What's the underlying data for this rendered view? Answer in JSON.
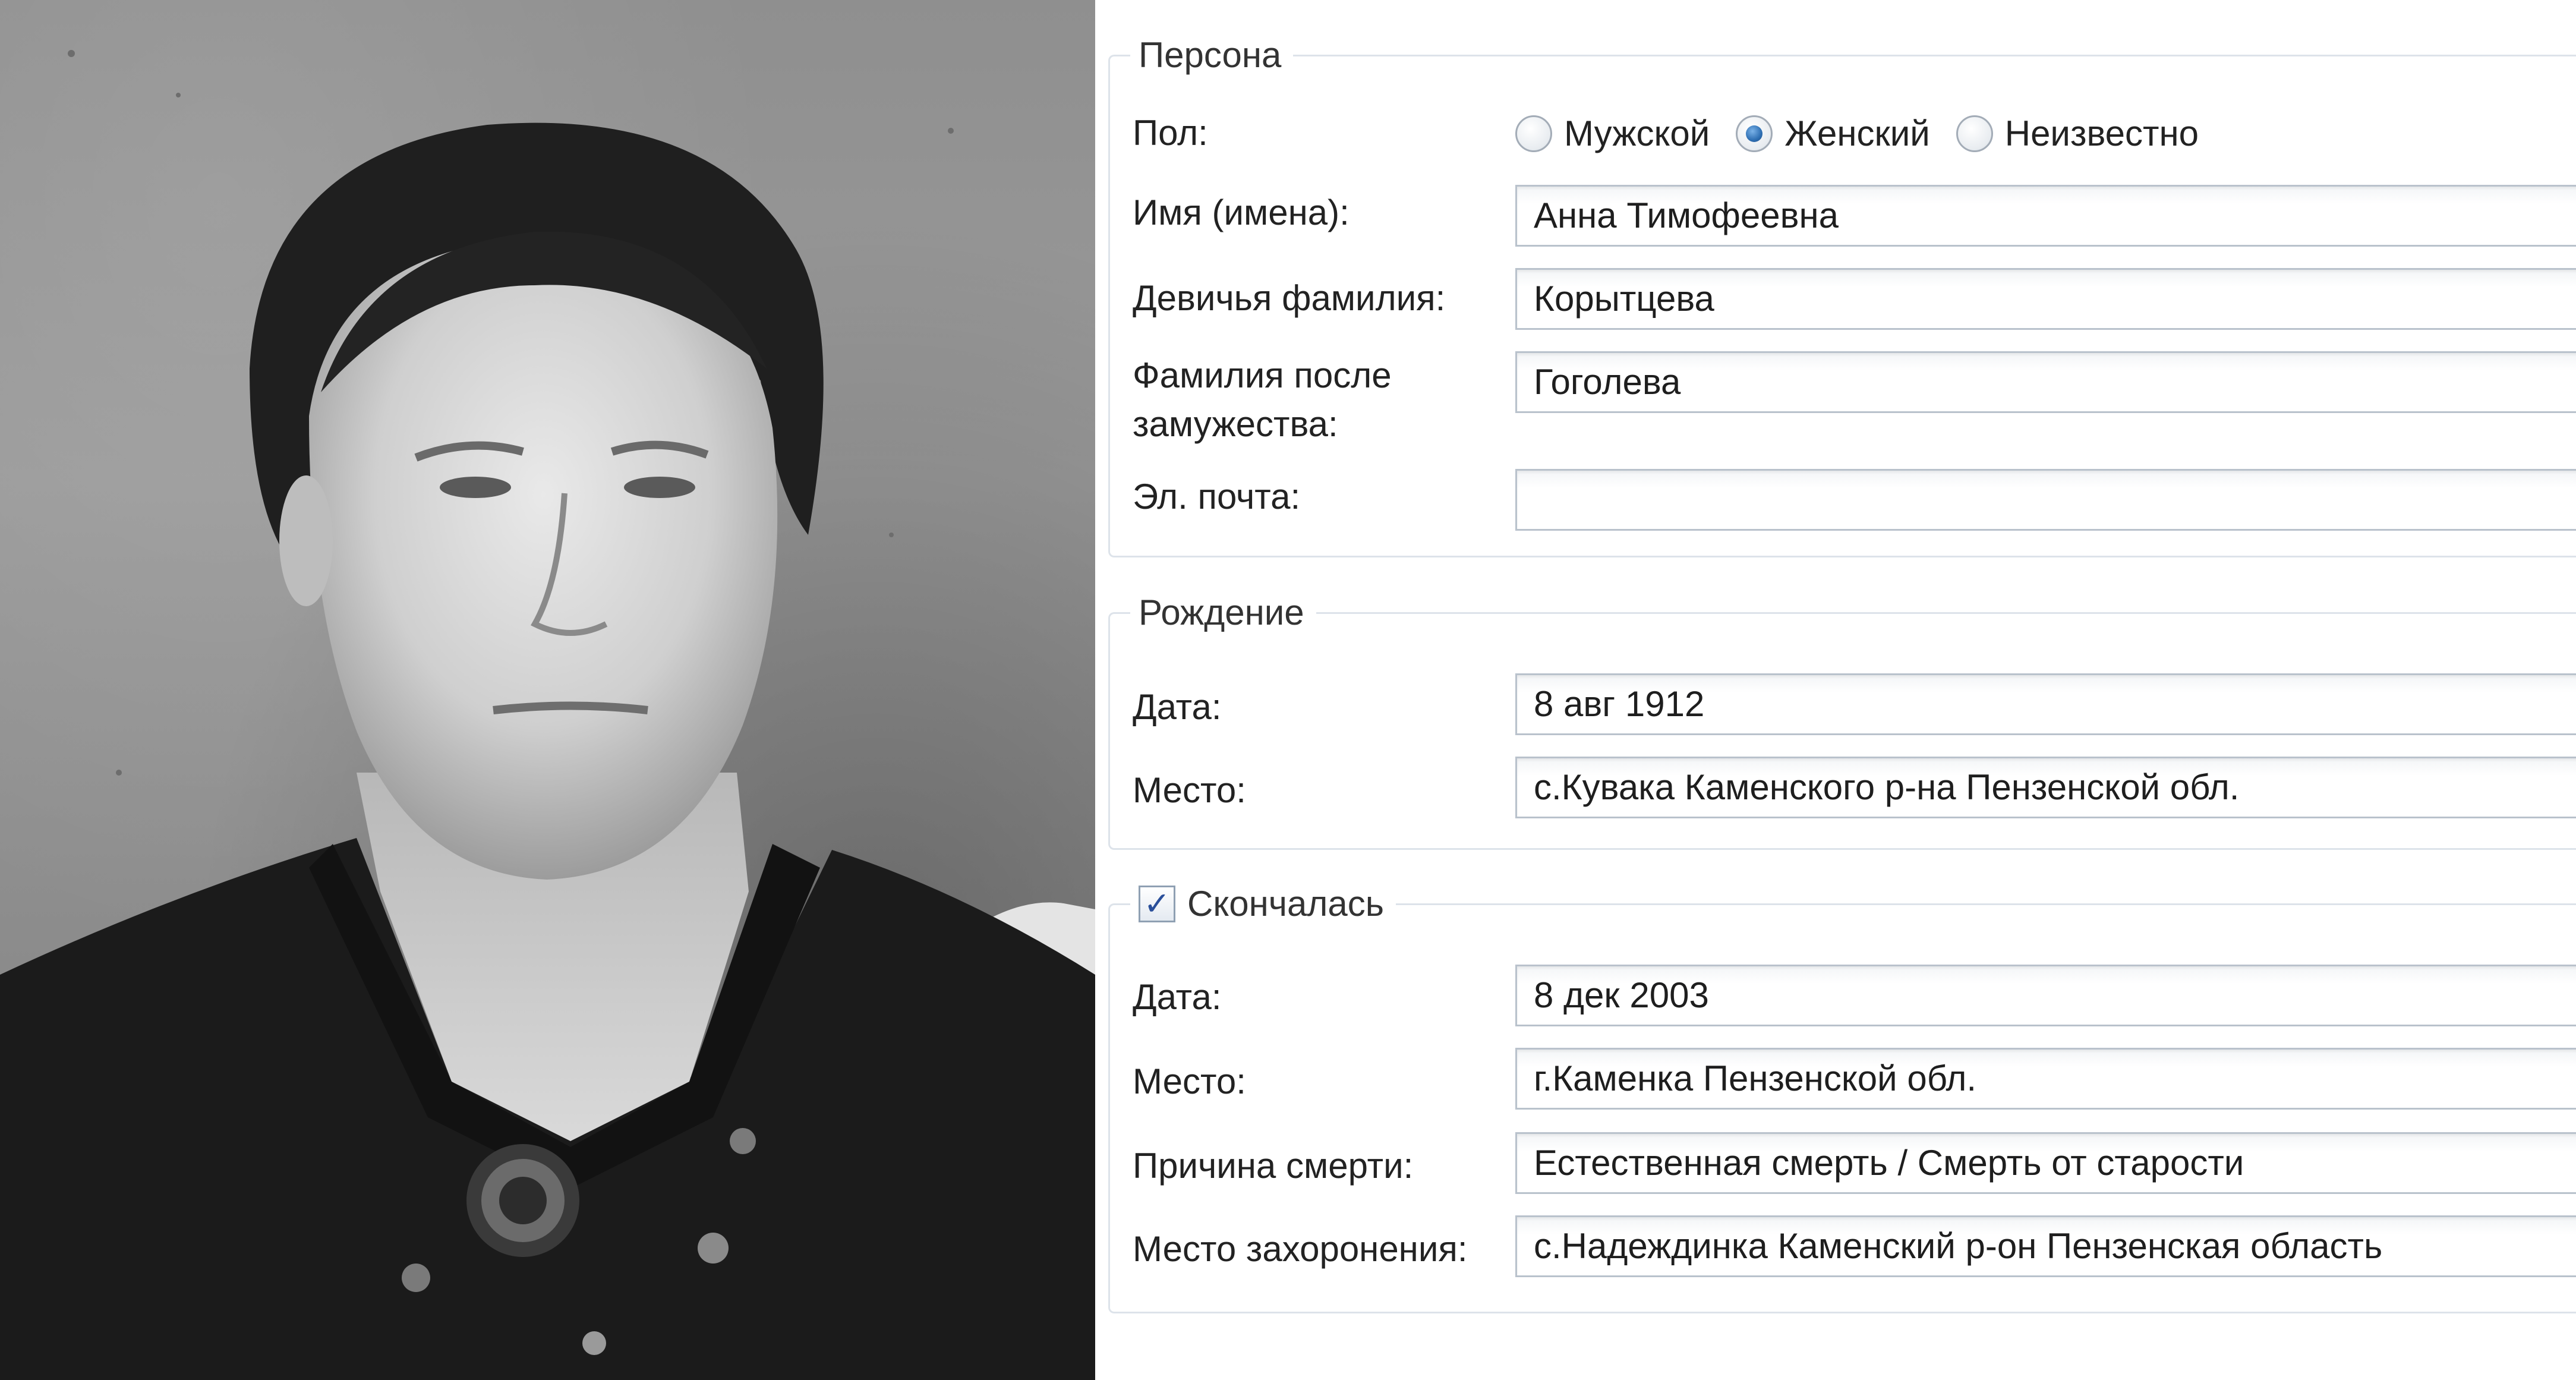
{
  "photo": {
    "alt": "portrait"
  },
  "person": {
    "legend": "Персона",
    "gender": {
      "label": "Пол:",
      "options": [
        "Мужской",
        "Женский",
        "Неизвестно"
      ],
      "selected": "Женский"
    },
    "given_names": {
      "label": "Имя (имена):",
      "value": "Анна Тимофеевна"
    },
    "maiden_name": {
      "label": "Девичья фамилия:",
      "value": "Корытцева"
    },
    "married_name": {
      "label_line1": "Фамилия после",
      "label_line2": "замужества:",
      "value": "Гоголева"
    },
    "email": {
      "label": "Эл. почта:",
      "value": ""
    }
  },
  "birth": {
    "legend": "Рождение",
    "date": {
      "label": "Дата:",
      "value": "8 авг 1912"
    },
    "place": {
      "label": "Место:",
      "value": "с.Кувака Каменского р-на Пензенской обл."
    }
  },
  "death": {
    "legend": "Скончалась",
    "checked": true,
    "checkbox_glyph": "✓",
    "date": {
      "label": "Дата:",
      "value": "8 дек 2003"
    },
    "place": {
      "label": "Место:",
      "value": "г.Каменка Пензенской обл."
    },
    "cause": {
      "label": "Причина смерти:",
      "value": "Естественная смерть / Смерть от старости"
    },
    "burial": {
      "label": "Место захоронения:",
      "value": "с.Надеждинка Каменский р-он Пензенская область"
    }
  }
}
